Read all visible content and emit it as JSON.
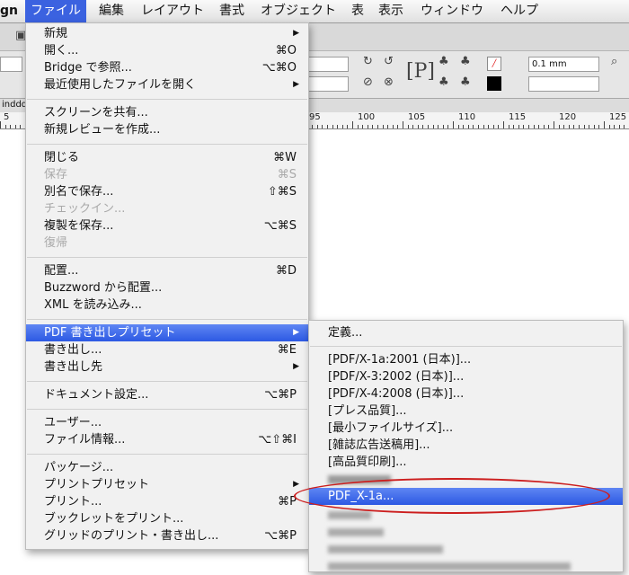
{
  "menubar": {
    "app_partial": "gn",
    "items": [
      "ファイル",
      "編集",
      "レイアウト",
      "書式",
      "オブジェクト",
      "表",
      "表示",
      "ウィンドウ",
      "ヘルプ"
    ]
  },
  "toolbar": {
    "stroke_weight": "0.1 mm",
    "tab_partial": "inddd"
  },
  "ruler": {
    "labels": [
      "5",
      "95",
      "100",
      "105",
      "110",
      "115",
      "120",
      "125"
    ]
  },
  "file_menu": {
    "new": {
      "label": "新規"
    },
    "open": {
      "label": "開く...",
      "shortcut": "⌘O"
    },
    "bridge": {
      "label": "Bridge で参照...",
      "shortcut": "⌥⌘O"
    },
    "recent": {
      "label": "最近使用したファイルを開く"
    },
    "share_screen": {
      "label": "スクリーンを共有..."
    },
    "new_review": {
      "label": "新規レビューを作成..."
    },
    "close": {
      "label": "閉じる",
      "shortcut": "⌘W"
    },
    "save": {
      "label": "保存",
      "shortcut": "⌘S"
    },
    "save_as": {
      "label": "別名で保存...",
      "shortcut": "⇧⌘S"
    },
    "check_in": {
      "label": "チェックイン..."
    },
    "save_copy": {
      "label": "複製を保存...",
      "shortcut": "⌥⌘S"
    },
    "revert": {
      "label": "復帰"
    },
    "place": {
      "label": "配置...",
      "shortcut": "⌘D"
    },
    "buzzword_place": {
      "label": "Buzzword から配置..."
    },
    "import_xml": {
      "label": "XML を読み込み..."
    },
    "pdf_presets": {
      "label": "PDF 書き出しプリセット"
    },
    "export": {
      "label": "書き出し...",
      "shortcut": "⌘E"
    },
    "export_for": {
      "label": "書き出し先"
    },
    "doc_setup": {
      "label": "ドキュメント設定...",
      "shortcut": "⌥⌘P"
    },
    "user": {
      "label": "ユーザー..."
    },
    "file_info": {
      "label": "ファイル情報...",
      "shortcut": "⌥⇧⌘I"
    },
    "package": {
      "label": "パッケージ..."
    },
    "print_presets": {
      "label": "プリントプリセット"
    },
    "print": {
      "label": "プリント...",
      "shortcut": "⌘P"
    },
    "print_booklet": {
      "label": "ブックレットをプリント..."
    },
    "grid_print": {
      "label": "グリッドのプリント・書き出し...",
      "shortcut": "⌥⌘P"
    }
  },
  "submenu": {
    "define": "定義...",
    "items": [
      "[PDF/X-1a:2001 (日本)]...",
      "[PDF/X-3:2002 (日本)]...",
      "[PDF/X-4:2008 (日本)]...",
      "[プレス品質]...",
      "[最小ファイルサイズ]...",
      "[雑誌広告送稿用]...",
      "[高品質印刷]..."
    ],
    "highlighted": "PDF_X-1a..."
  }
}
